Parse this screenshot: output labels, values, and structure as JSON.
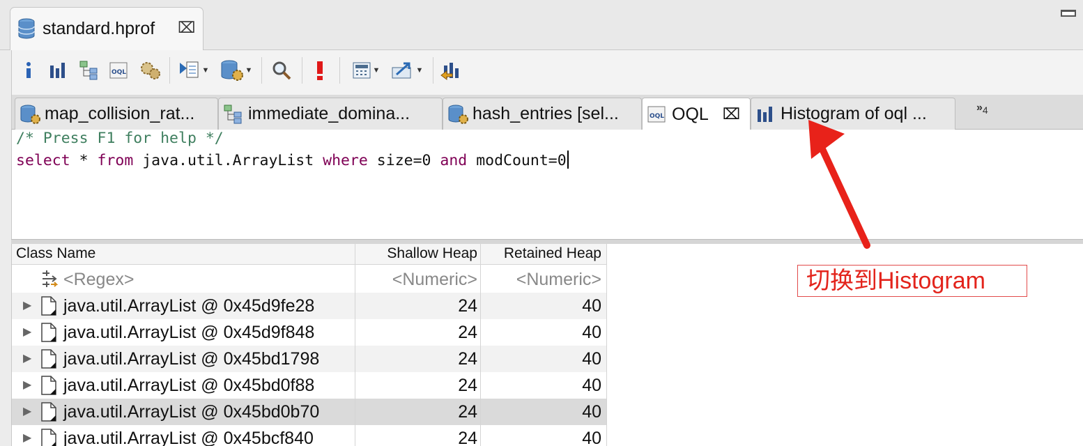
{
  "editor_tab": {
    "title": "standard.hprof",
    "close_glyph": "⌧"
  },
  "toolbar": {
    "buttons": [
      {
        "name": "info-icon"
      },
      {
        "name": "histogram-icon"
      },
      {
        "name": "dominator-tree-icon"
      },
      {
        "name": "oql-icon"
      },
      {
        "name": "thread-overview-icon"
      },
      {
        "name": "run-report-icon"
      },
      {
        "name": "query-browser-icon"
      },
      {
        "name": "search-icon"
      },
      {
        "name": "leak-suspects-icon"
      },
      {
        "name": "calculator-icon"
      },
      {
        "name": "export-icon"
      },
      {
        "name": "heap-dump-overview-icon"
      }
    ]
  },
  "query_tabs": [
    {
      "label": "map_collision_rat...",
      "icon": "database-gear-icon",
      "active": false
    },
    {
      "label": "immediate_domina...",
      "icon": "dominator-tree-icon",
      "active": false
    },
    {
      "label": "hash_entries [sel...",
      "icon": "database-gear-icon",
      "active": false
    },
    {
      "label": "OQL",
      "icon": "oql-icon",
      "active": true,
      "close_glyph": "⌧"
    },
    {
      "label": "Histogram of oql ...",
      "icon": "histogram-icon",
      "active": false
    }
  ],
  "more_tabs": {
    "glyph": "»",
    "count": "4"
  },
  "query": {
    "comment": "/* Press F1 for help */",
    "tokens": [
      {
        "t": "select",
        "kw": true
      },
      {
        "t": " * ",
        "kw": false
      },
      {
        "t": "from",
        "kw": true
      },
      {
        "t": " java.util.ArrayList ",
        "kw": false
      },
      {
        "t": "where",
        "kw": true
      },
      {
        "t": " size=0 ",
        "kw": false
      },
      {
        "t": "and",
        "kw": true
      },
      {
        "t": " modCount=0",
        "kw": false
      }
    ]
  },
  "table": {
    "columns": [
      "Class Name",
      "Shallow Heap",
      "Retained Heap"
    ],
    "filter": {
      "name": "<Regex>",
      "shallow": "<Numeric>",
      "retained": "<Numeric>"
    },
    "rows": [
      {
        "name": "java.util.ArrayList @ 0x45d9fe28",
        "shallow": "24",
        "retained": "40"
      },
      {
        "name": "java.util.ArrayList @ 0x45d9f848",
        "shallow": "24",
        "retained": "40"
      },
      {
        "name": "java.util.ArrayList @ 0x45bd1798",
        "shallow": "24",
        "retained": "40"
      },
      {
        "name": "java.util.ArrayList @ 0x45bd0f88",
        "shallow": "24",
        "retained": "40"
      },
      {
        "name": "java.util.ArrayList @ 0x45bd0b70",
        "shallow": "24",
        "retained": "40"
      },
      {
        "name": "java.util.ArrayList @ 0x45bcf840",
        "shallow": "24",
        "retained": "40"
      }
    ],
    "selected_row": 4
  },
  "annotation": {
    "text": "切换到Histogram",
    "color": "#e3241c"
  }
}
